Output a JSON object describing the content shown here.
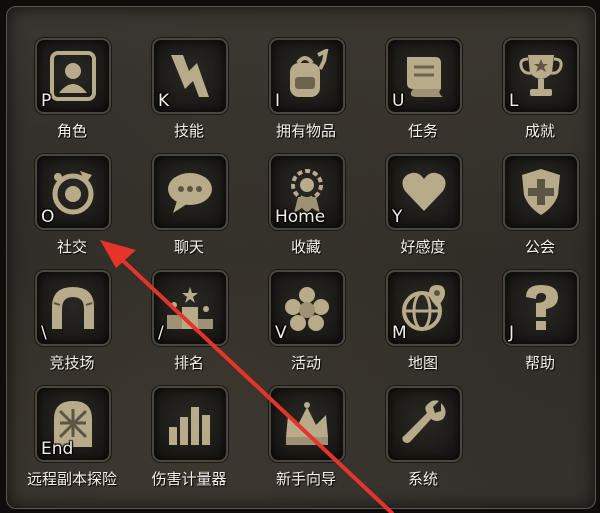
{
  "menu": {
    "items": [
      {
        "label": "角色",
        "hotkey": "P",
        "icon": "character-portrait-icon"
      },
      {
        "label": "技能",
        "hotkey": "K",
        "icon": "lightning-skill-icon"
      },
      {
        "label": "拥有物品",
        "hotkey": "I",
        "icon": "backpack-icon"
      },
      {
        "label": "任务",
        "hotkey": "U",
        "icon": "quest-scroll-icon"
      },
      {
        "label": "成就",
        "hotkey": "L",
        "icon": "trophy-icon"
      },
      {
        "label": "社交",
        "hotkey": "O",
        "icon": "social-circle-icon"
      },
      {
        "label": "聊天",
        "hotkey": "",
        "icon": "chat-bubble-icon"
      },
      {
        "label": "收藏",
        "hotkey": "Home",
        "icon": "medal-collection-icon"
      },
      {
        "label": "好感度",
        "hotkey": "Y",
        "icon": "heart-icon"
      },
      {
        "label": "公会",
        "hotkey": "",
        "icon": "guild-shield-icon"
      },
      {
        "label": "竞技场",
        "hotkey": "\\",
        "icon": "arena-gate-icon"
      },
      {
        "label": "排名",
        "hotkey": "/",
        "icon": "ranking-podium-icon"
      },
      {
        "label": "活动",
        "hotkey": "V",
        "icon": "event-star-icon"
      },
      {
        "label": "地图",
        "hotkey": "M",
        "icon": "globe-map-icon"
      },
      {
        "label": "帮助",
        "hotkey": "J",
        "icon": "question-mark-icon"
      },
      {
        "label": "远程副本探险",
        "hotkey": "End",
        "icon": "dungeon-door-icon"
      },
      {
        "label": "伤害计量器",
        "hotkey": "",
        "icon": "bar-meter-icon"
      },
      {
        "label": "新手向导",
        "hotkey": "",
        "icon": "crown-guide-icon"
      },
      {
        "label": "系统",
        "hotkey": "",
        "icon": "wrench-system-icon"
      }
    ]
  },
  "colors": {
    "arrow": "#e8332b",
    "icon": "#b8ab8a",
    "text": "#f4f1e8"
  }
}
